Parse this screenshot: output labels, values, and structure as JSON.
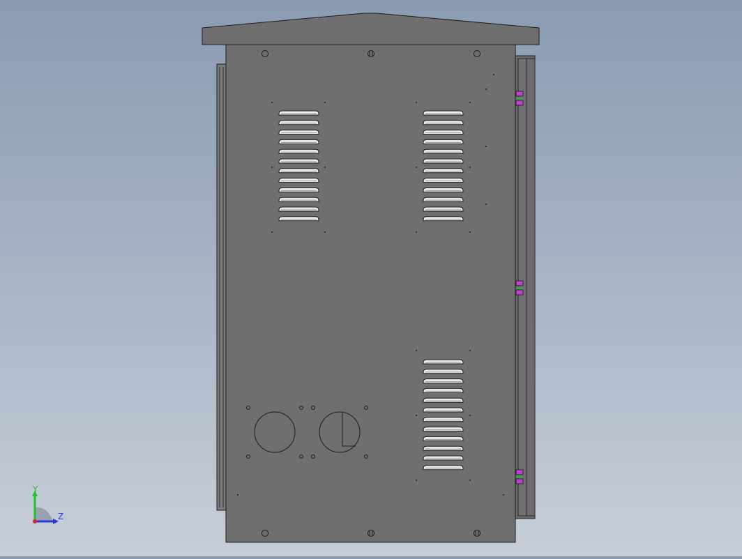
{
  "viewport": {
    "background_top": "#8a9bb2",
    "background_bottom": "#c7ced8",
    "model": {
      "body_color": "#6f6f6f",
      "edge_color": "#1c1c1c",
      "louver_color": "#e8e8e8",
      "side_panel_color": "#7a7a7a",
      "hinge_color": "#c23fd1",
      "hinge_accent": "#3aa04a"
    }
  },
  "triad": {
    "y_label": "Y",
    "z_label": "Z",
    "y_color": "#1fbf2a",
    "z_color": "#2a3cd6",
    "origin_color": "#d8262a"
  }
}
